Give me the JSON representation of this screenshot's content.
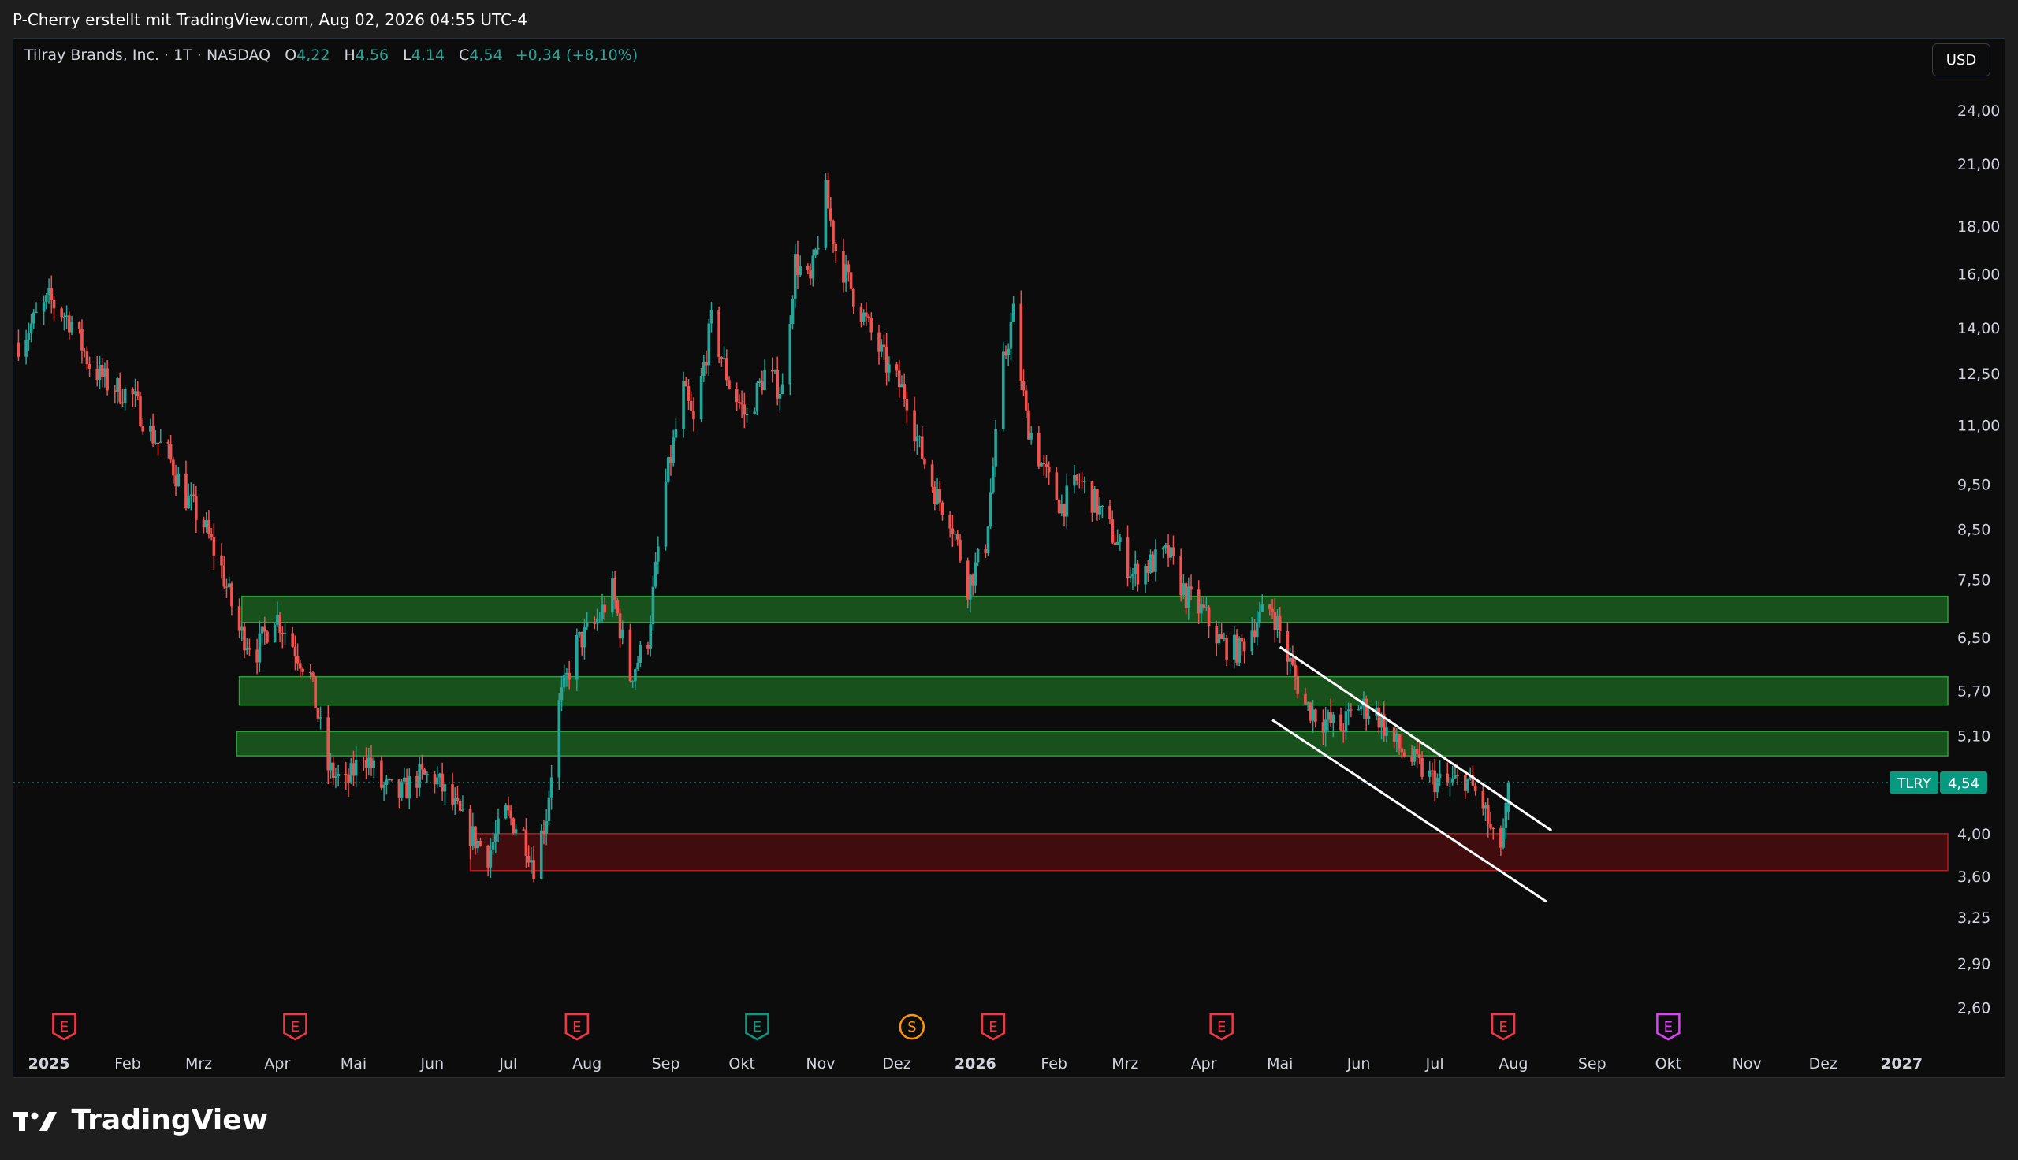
{
  "header": {
    "watermark": "P-Cherry erstellt mit TradingView.com, Aug 02, 2026 04:55 UTC-4"
  },
  "legend": {
    "symbol_name": "Tilray Brands, Inc. · 1T · NASDAQ",
    "open_key": "O",
    "open": "4,22",
    "high_key": "H",
    "high": "4,56",
    "low_key": "L",
    "low": "4,14",
    "close_key": "C",
    "close": "4,54",
    "change": "+0,34 (+8,10%)"
  },
  "currency_button": "USD",
  "price_label": {
    "ticker": "TLRY",
    "price": "4,54"
  },
  "footer": {
    "brand": "TradingView"
  },
  "colors": {
    "up": "#26a69a",
    "down": "#ef5350",
    "background": "#0c0c0c",
    "support_zone": "#1b5e20",
    "demand_zone": "#4a0d0f",
    "channel": "#ffffff"
  },
  "chart_data": {
    "type": "candlestick",
    "symbol": "TLRY",
    "timeframe": "1T",
    "scale": "log",
    "y_tick_labels": [
      "24,00",
      "21,00",
      "18,00",
      "16,00",
      "14,00",
      "12,50",
      "11,00",
      "9,50",
      "8,50",
      "7,50",
      "6,50",
      "5,70",
      "5,10",
      "4,00",
      "3,60",
      "3,25",
      "2,90",
      "2,60"
    ],
    "y_ticks": [
      24.0,
      21.0,
      18.0,
      16.0,
      14.0,
      12.5,
      11.0,
      9.5,
      8.5,
      7.5,
      6.5,
      5.7,
      5.1,
      4.0,
      3.6,
      3.25,
      2.9,
      2.6
    ],
    "x_tick_labels": [
      "2025",
      "Feb",
      "Mrz",
      "Apr",
      "Mai",
      "Jun",
      "Jul",
      "Aug",
      "Sep",
      "Okt",
      "Nov",
      "Dez",
      "2026",
      "Feb",
      "Mrz",
      "Apr",
      "Mai",
      "Jun",
      "Jul",
      "Aug",
      "Sep",
      "Okt",
      "Nov",
      "Dez",
      "2027"
    ],
    "x_ticks": [
      "2025-01-01",
      "2025-02-01",
      "2025-03-01",
      "2025-04-01",
      "2025-05-01",
      "2025-06-01",
      "2025-07-01",
      "2025-08-01",
      "2025-09-01",
      "2025-10-01",
      "2025-11-01",
      "2025-12-01",
      "2026-01-01",
      "2026-02-01",
      "2026-03-01",
      "2026-04-01",
      "2026-05-01",
      "2026-06-01",
      "2026-07-01",
      "2026-08-01",
      "2026-09-01",
      "2026-10-01",
      "2026-11-01",
      "2026-12-01",
      "2027-01-01"
    ],
    "x_range": [
      "2024-12-18",
      "2027-01-21"
    ],
    "y_range": [
      2.45,
      26.5
    ],
    "close_series": [
      [
        "2024-12-20",
        13.5
      ],
      [
        "2025-01-01",
        15.0
      ],
      [
        "2025-01-10",
        14.2
      ],
      [
        "2025-01-17",
        12.8
      ],
      [
        "2025-01-24",
        12.2
      ],
      [
        "2025-02-03",
        11.8
      ],
      [
        "2025-02-10",
        10.8
      ],
      [
        "2025-02-17",
        10.2
      ],
      [
        "2025-02-24",
        9.2
      ],
      [
        "2025-03-03",
        8.6
      ],
      [
        "2025-03-10",
        7.7
      ],
      [
        "2025-03-17",
        6.6
      ],
      [
        "2025-03-24",
        6.3
      ],
      [
        "2025-03-31",
        6.9
      ],
      [
        "2025-04-07",
        6.4
      ],
      [
        "2025-04-14",
        5.9
      ],
      [
        "2025-04-21",
        4.7
      ],
      [
        "2025-04-28",
        4.5
      ],
      [
        "2025-05-05",
        4.9
      ],
      [
        "2025-05-12",
        4.5
      ],
      [
        "2025-05-19",
        4.4
      ],
      [
        "2025-05-26",
        4.6
      ],
      [
        "2025-06-02",
        4.6
      ],
      [
        "2025-06-09",
        4.3
      ],
      [
        "2025-06-16",
        4.0
      ],
      [
        "2025-06-23",
        3.8
      ],
      [
        "2025-06-30",
        4.2
      ],
      [
        "2025-07-07",
        4.0
      ],
      [
        "2025-07-11",
        3.7
      ],
      [
        "2025-07-16",
        4.2
      ],
      [
        "2025-07-21",
        5.5
      ],
      [
        "2025-07-28",
        6.4
      ],
      [
        "2025-08-04",
        6.7
      ],
      [
        "2025-08-11",
        7.3
      ],
      [
        "2025-08-18",
        5.9
      ],
      [
        "2025-08-25",
        6.5
      ],
      [
        "2025-09-01",
        9.5
      ],
      [
        "2025-09-08",
        12.0
      ],
      [
        "2025-09-12",
        11.0
      ],
      [
        "2025-09-19",
        14.2
      ],
      [
        "2025-09-26",
        12.2
      ],
      [
        "2025-10-03",
        11.2
      ],
      [
        "2025-10-10",
        12.5
      ],
      [
        "2025-10-17",
        12.0
      ],
      [
        "2025-10-22",
        16.5
      ],
      [
        "2025-10-28",
        15.6
      ],
      [
        "2025-11-03",
        19.5
      ],
      [
        "2025-11-07",
        17.0
      ],
      [
        "2025-11-14",
        15.2
      ],
      [
        "2025-11-21",
        13.8
      ],
      [
        "2025-11-28",
        12.6
      ],
      [
        "2025-12-05",
        11.8
      ],
      [
        "2025-12-10",
        10.4
      ],
      [
        "2025-12-17",
        9.2
      ],
      [
        "2025-12-22",
        8.8
      ],
      [
        "2025-12-29",
        7.4
      ],
      [
        "2026-01-05",
        8.2
      ],
      [
        "2026-01-12",
        12.8
      ],
      [
        "2026-01-16",
        14.5
      ],
      [
        "2026-01-21",
        11.2
      ],
      [
        "2026-01-28",
        9.8
      ],
      [
        "2026-02-04",
        9.0
      ],
      [
        "2026-02-11",
        9.6
      ],
      [
        "2026-02-18",
        9.0
      ],
      [
        "2026-02-25",
        8.3
      ],
      [
        "2026-03-04",
        7.6
      ],
      [
        "2026-03-11",
        7.8
      ],
      [
        "2026-03-18",
        8.0
      ],
      [
        "2026-03-25",
        7.2
      ],
      [
        "2026-04-01",
        6.9
      ],
      [
        "2026-04-08",
        6.4
      ],
      [
        "2026-04-15",
        6.3
      ],
      [
        "2026-04-22",
        6.8
      ],
      [
        "2026-04-28",
        7.0
      ],
      [
        "2026-05-04",
        6.2
      ],
      [
        "2026-05-11",
        5.5
      ],
      [
        "2026-05-18",
        5.3
      ],
      [
        "2026-05-25",
        5.2
      ],
      [
        "2026-06-01",
        5.5
      ],
      [
        "2026-06-08",
        5.4
      ],
      [
        "2026-06-15",
        5.0
      ],
      [
        "2026-06-22",
        4.8
      ],
      [
        "2026-06-29",
        4.6
      ],
      [
        "2026-07-06",
        4.5
      ],
      [
        "2026-07-13",
        4.6
      ],
      [
        "2026-07-20",
        4.3
      ],
      [
        "2026-07-26",
        3.75
      ],
      [
        "2026-07-29",
        4.2
      ],
      [
        "2026-07-31",
        4.54
      ]
    ],
    "last_candle": {
      "open": 4.22,
      "high": 4.56,
      "low": 4.14,
      "close": 4.54
    },
    "zones": [
      {
        "kind": "support",
        "from": "2025-03-18",
        "low": 6.75,
        "high": 7.2
      },
      {
        "kind": "support",
        "from": "2025-03-17",
        "low": 5.5,
        "high": 5.9
      },
      {
        "kind": "support",
        "from": "2025-03-16",
        "low": 4.85,
        "high": 5.15
      },
      {
        "kind": "demand",
        "from": "2025-06-16",
        "low": 3.65,
        "high": 4.0
      }
    ],
    "channel": [
      {
        "from": [
          "2026-05-01",
          6.35
        ],
        "to": [
          "2026-08-16",
          4.03
        ]
      },
      {
        "from": [
          "2026-04-28",
          5.3
        ],
        "to": [
          "2026-08-14",
          3.38
        ]
      }
    ],
    "events": [
      {
        "date": "2025-01-07",
        "type": "E",
        "color": "red"
      },
      {
        "date": "2025-04-08",
        "type": "E",
        "color": "red"
      },
      {
        "date": "2025-07-28",
        "type": "E",
        "color": "red"
      },
      {
        "date": "2025-10-07",
        "type": "E",
        "color": "green"
      },
      {
        "date": "2025-12-07",
        "type": "S",
        "color": "orange"
      },
      {
        "date": "2026-01-08",
        "type": "E",
        "color": "red"
      },
      {
        "date": "2026-04-08",
        "type": "E",
        "color": "red"
      },
      {
        "date": "2026-07-28",
        "type": "E",
        "color": "red"
      },
      {
        "date": "2026-10-01",
        "type": "E",
        "color": "magenta"
      }
    ]
  }
}
